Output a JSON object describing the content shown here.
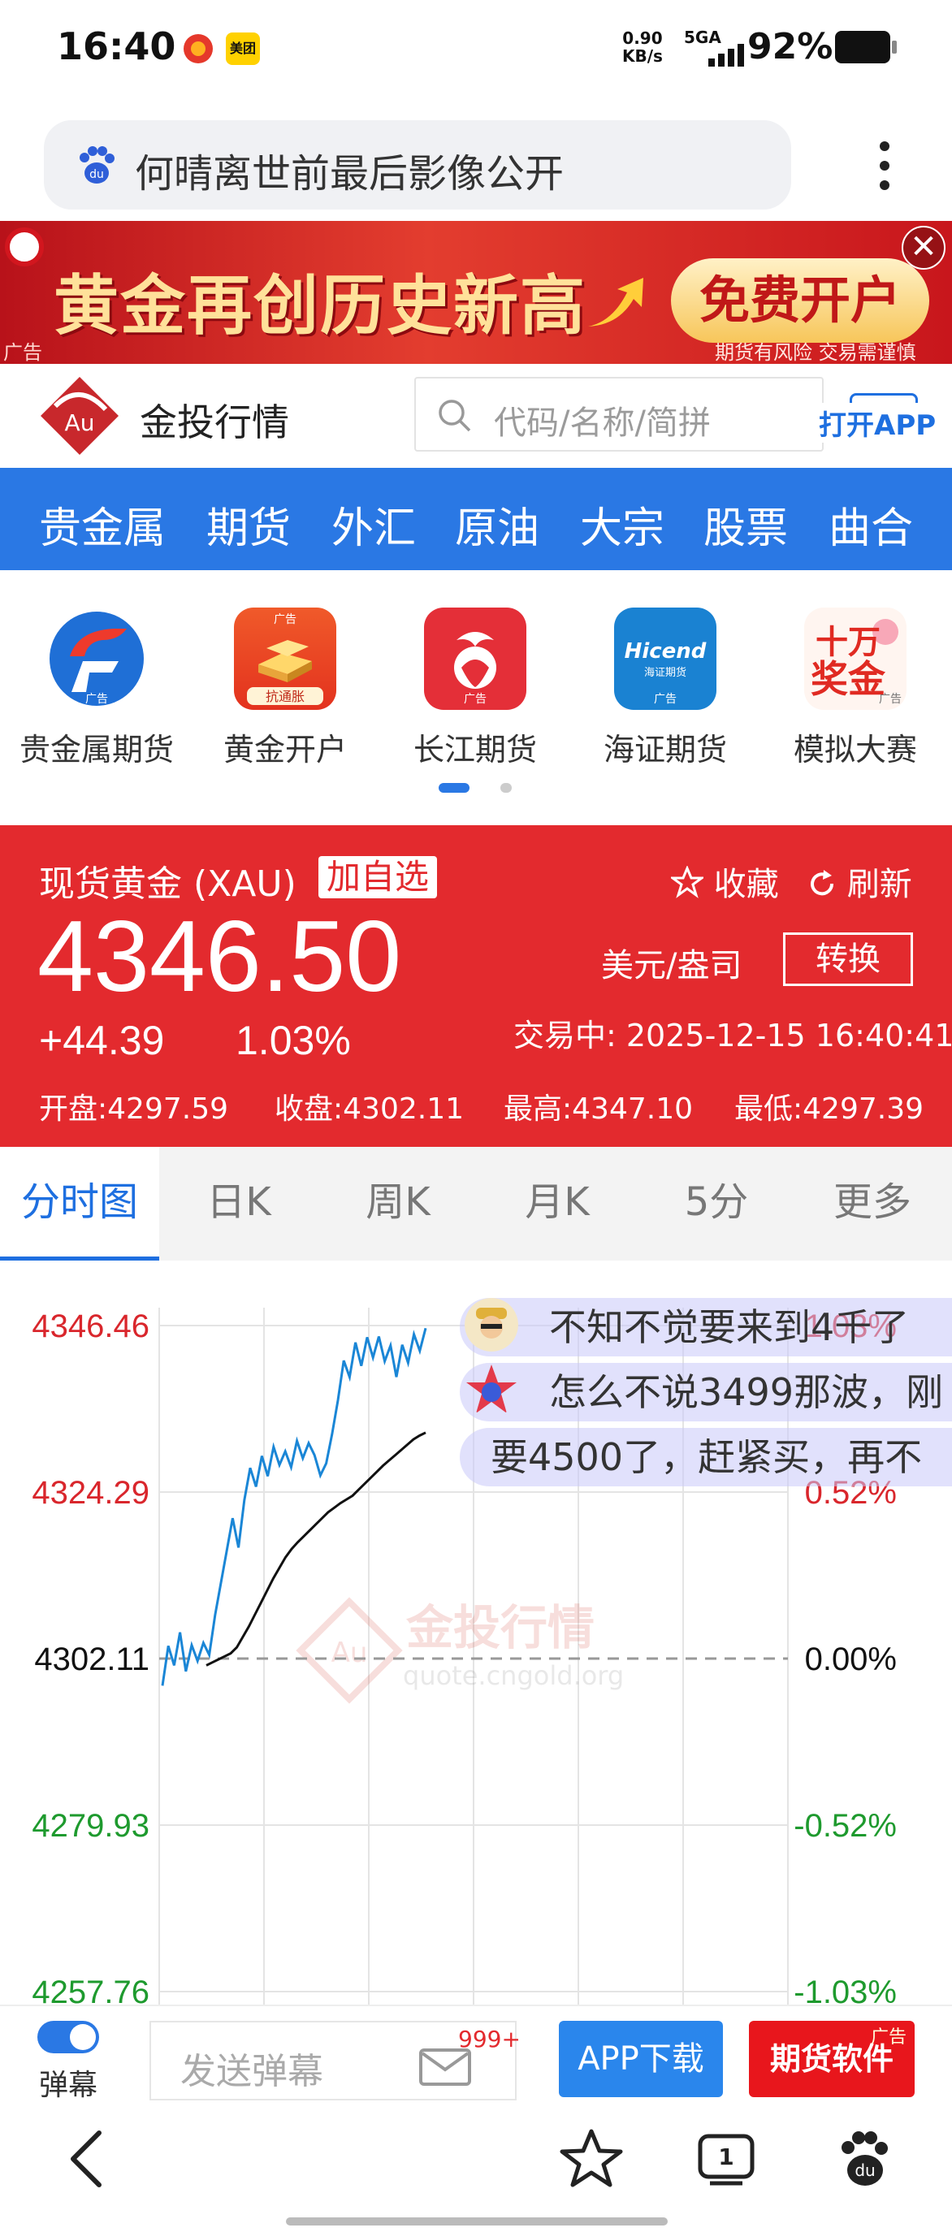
{
  "status_bar": {
    "time": "16:40",
    "app2_label": "美团",
    "net_speed_value": "0.90",
    "net_speed_unit": "KB/s",
    "signal": "5GA",
    "battery": "92%"
  },
  "browser_search": {
    "query": "何晴离世前最后影像公开"
  },
  "ad_banner": {
    "title": "黄金再创历史新高",
    "button": "免费开户",
    "tag": "广告",
    "risk": "期货有风险 交易需谨慎",
    "close": "✕"
  },
  "site_header": {
    "logo_text": "Au",
    "name": "金投行情",
    "search_placeholder": "代码/名称/简拼",
    "open_app": "打开APP"
  },
  "category_nav": [
    "贵金属",
    "期货",
    "外汇",
    "原油",
    "大宗",
    "股票",
    "曲合"
  ],
  "partners": [
    {
      "label": "贵金属期货",
      "tag": "广告"
    },
    {
      "label": "黄金开户",
      "tag": "广告",
      "badge": "抗通胀"
    },
    {
      "label": "长江期货",
      "tag": "广告"
    },
    {
      "label": "海证期货",
      "tag": "广告",
      "brand": "Hicend",
      "brand_sub": "海证期货"
    },
    {
      "label": "模拟大赛",
      "tag": "广告",
      "art": "十万奖金"
    }
  ],
  "quote": {
    "name": "现货黄金 (XAU)",
    "add_watch": "加自选",
    "favorite": "收藏",
    "refresh": "刷新",
    "price": "4346.50",
    "unit": "美元/盎司",
    "convert": "转换",
    "change": "+44.39",
    "change_pct": "1.03%",
    "trade_time": "交易中:  2025-12-15 16:40:41",
    "open": "开盘:4297.59",
    "close": "收盘:4302.11",
    "high": "最高:4347.10",
    "low": "最低:4297.39",
    "colors": {
      "up": "#e32a2e",
      "accent": "#2a78e4"
    }
  },
  "chart_tabs": [
    "分时图",
    "日K",
    "周K",
    "月K",
    "5分",
    "更多"
  ],
  "chart_data": {
    "type": "line",
    "title": "",
    "ylim": [
      4257.76,
      4346.46
    ],
    "y_ticks_left": [
      "4346.46",
      "4324.29",
      "4302.11",
      "4279.93",
      "4257.76"
    ],
    "y_ticks_right": [
      "1.03%",
      "0.52%",
      "0.00%",
      "-0.52%",
      "-1.03%"
    ],
    "baseline": 4302.11,
    "grid": true,
    "watermark": "金投行情",
    "watermark_sub": "quote.cngold.org",
    "series": [
      {
        "color": "#1a86d6",
        "values": [
          4298.5,
          4303.8,
          4301.2,
          4305.6,
          4300.4,
          4303.9,
          4301.8,
          4304.2,
          4302.6,
          4307.9,
          4312.2,
          4316.5,
          4320.8,
          4316.9,
          4323.2,
          4327.5,
          4325.0,
          4329.1,
          4326.4,
          4330.3,
          4327.9,
          4329.7,
          4327.6,
          4331.1,
          4328.8,
          4330.8,
          4329.2,
          4326.5,
          4328.1,
          4332.0,
          4336.5,
          4341.8,
          4339.6,
          4344.2,
          4341.1,
          4344.9,
          4342.2,
          4345.0,
          4341.7,
          4343.8,
          4339.6,
          4343.9,
          4341.5,
          4345.3,
          4343.1,
          4346.1
        ]
      },
      {
        "color": "#111111",
        "values": [
          4301.2,
          4301.6,
          4302.0,
          4302.4,
          4302.8,
          4303.6,
          4305.0,
          4306.4,
          4308.0,
          4309.6,
          4311.2,
          4312.8,
          4314.2,
          4315.6,
          4316.7,
          4317.6,
          4318.4,
          4319.2,
          4320.0,
          4320.8,
          4321.6,
          4322.2,
          4322.8,
          4323.3,
          4323.8,
          4324.6,
          4325.4,
          4326.2,
          4327.0,
          4327.8,
          4328.5,
          4329.2,
          4329.9,
          4330.6,
          4331.3,
          4331.8,
          4332.2
        ]
      }
    ]
  },
  "danmaku": [
    "不知不觉要来到4千了",
    "怎么不说3499那波，刚",
    "要4500了，赶紧买，再不"
  ],
  "input_bar": {
    "toggle_label": "弹幕",
    "placeholder": "发送弹幕",
    "badge": "999+",
    "app_download": "APP下载",
    "futures_software": "期货软件",
    "ad_tag": "广告"
  }
}
